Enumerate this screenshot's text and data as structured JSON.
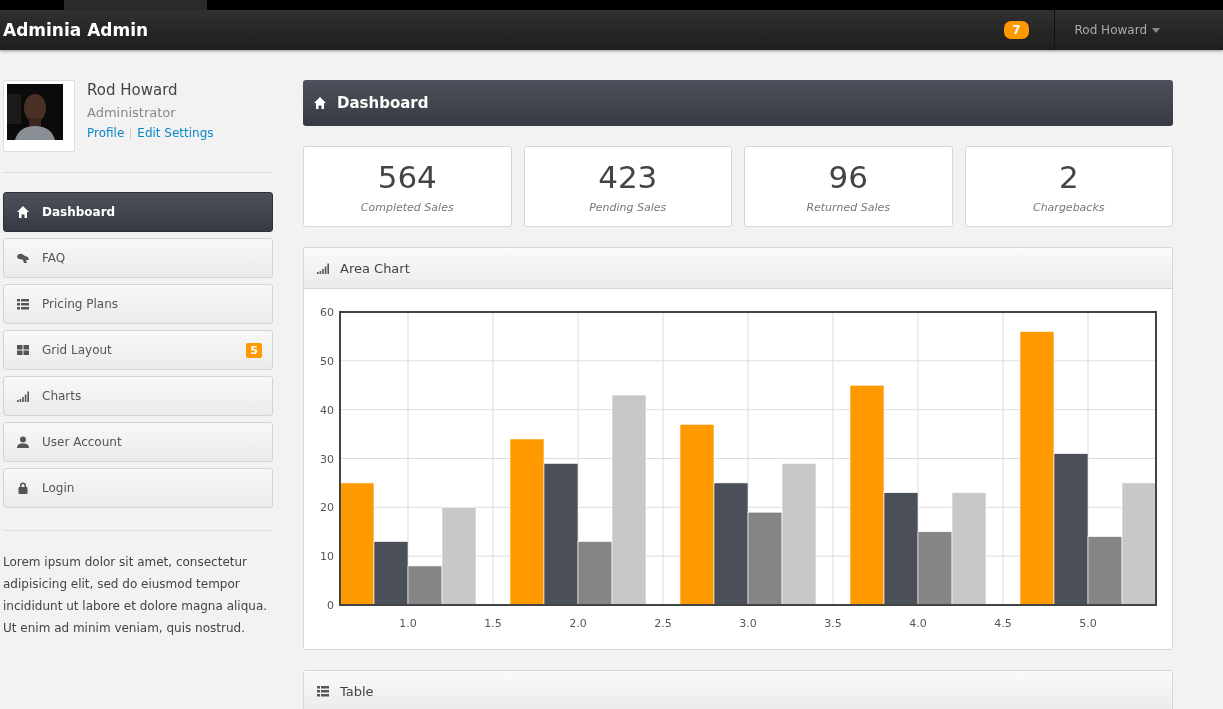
{
  "header": {
    "brand": "Adminia Admin",
    "notification_count": "7",
    "user_menu": "Rod Howard"
  },
  "profile": {
    "name": "Rod Howard",
    "role": "Administrator",
    "links": [
      "Profile",
      "Edit Settings"
    ]
  },
  "sidebar": {
    "items": [
      {
        "label": "Dashboard",
        "kind": "home",
        "selected": true
      },
      {
        "label": "FAQ",
        "kind": "faq",
        "selected": false
      },
      {
        "label": "Pricing Plans",
        "kind": "list",
        "selected": false
      },
      {
        "label": "Grid Layout",
        "kind": "grid",
        "selected": false,
        "badge": "5"
      },
      {
        "label": "Charts",
        "kind": "signal",
        "selected": false
      },
      {
        "label": "User Account",
        "kind": "user",
        "selected": false
      },
      {
        "label": "Login",
        "kind": "lock",
        "selected": false
      }
    ],
    "about": "Lorem ipsum dolor sit amet, consectetur adipisicing elit, sed do eiusmod tempor incididunt ut labore et dolore magna aliqua. Ut enim ad minim veniam, quis nostrud."
  },
  "page_title": "Dashboard",
  "stats": [
    {
      "value": "564",
      "label": "Completed Sales"
    },
    {
      "value": "423",
      "label": "Pending Sales"
    },
    {
      "value": "96",
      "label": "Returned Sales"
    },
    {
      "value": "2",
      "label": "Chargebacks"
    }
  ],
  "chart_panel": {
    "title": "Area Chart",
    "chart_data": {
      "type": "bar",
      "x": [
        1,
        2,
        3,
        4,
        5
      ],
      "xlim": [
        0.6,
        5.4
      ],
      "ylim": [
        0,
        60
      ],
      "xticks": [
        {
          "value": 1,
          "label": "1.0"
        },
        {
          "value": 1.5,
          "label": "1.5"
        },
        {
          "value": 2,
          "label": "2.0"
        },
        {
          "value": 2.5,
          "label": "2.5"
        },
        {
          "value": 3,
          "label": "3.0"
        },
        {
          "value": 3.5,
          "label": "3.5"
        },
        {
          "value": 4,
          "label": "4.0"
        },
        {
          "value": 4.5,
          "label": "4.5"
        },
        {
          "value": 5,
          "label": "5.0"
        }
      ],
      "yticks": [
        0,
        10,
        20,
        30,
        40,
        50,
        60
      ],
      "grid": true,
      "series": [
        {
          "color": "#ff9900",
          "values": [
            25,
            34,
            37,
            45,
            56
          ]
        },
        {
          "color": "#4b4f58",
          "values": [
            13,
            29,
            25,
            23,
            31
          ]
        },
        {
          "color": "#858585",
          "values": [
            8,
            13,
            19,
            15,
            14
          ]
        },
        {
          "color": "#c8c8c8",
          "values": [
            20,
            43,
            29,
            23,
            25
          ]
        }
      ]
    }
  },
  "table_panel": {
    "title": "Table"
  }
}
